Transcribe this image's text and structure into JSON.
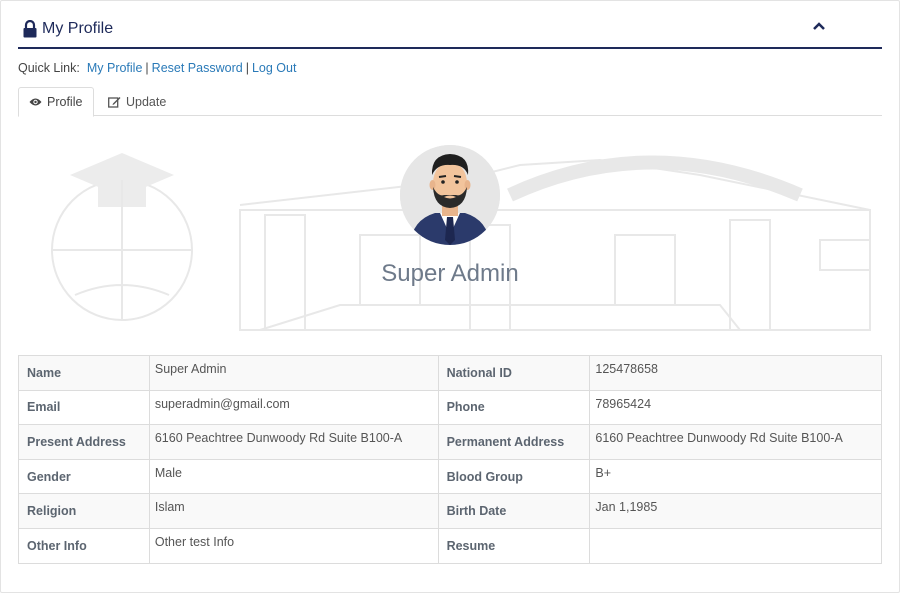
{
  "header": {
    "title": "My Profile",
    "lock_icon": "lock-icon",
    "collapse_icon": "chevron-up-icon",
    "accent_color": "#1e2a5a"
  },
  "quick_links": {
    "label": "Quick Link:",
    "items": [
      "My Profile",
      "Reset Password",
      "Log Out"
    ],
    "separator": "|",
    "link_color": "#2a7ab8"
  },
  "tabs": [
    {
      "label": "Profile",
      "icon": "eye-icon",
      "active": true
    },
    {
      "label": "Update",
      "icon": "edit-icon",
      "active": false
    }
  ],
  "profile": {
    "name": "Super Admin"
  },
  "details": [
    {
      "label1": "Name",
      "value1": "Super Admin",
      "label2": "National ID",
      "value2": "125478658"
    },
    {
      "label1": "Email",
      "value1": "superadmin@gmail.com",
      "label2": "Phone",
      "value2": "78965424"
    },
    {
      "label1": "Present Address",
      "value1": "6160 Peachtree Dunwoody Rd Suite B100-A",
      "label2": "Permanent Address",
      "value2": "6160 Peachtree Dunwoody Rd Suite B100-A"
    },
    {
      "label1": "Gender",
      "value1": "Male",
      "label2": "Blood Group",
      "value2": "B+"
    },
    {
      "label1": "Religion",
      "value1": "Islam",
      "label2": "Birth Date",
      "value2": "Jan 1,1985"
    },
    {
      "label1": "Other Info",
      "value1": "Other test Info",
      "label2": "Resume",
      "value2": ""
    }
  ]
}
